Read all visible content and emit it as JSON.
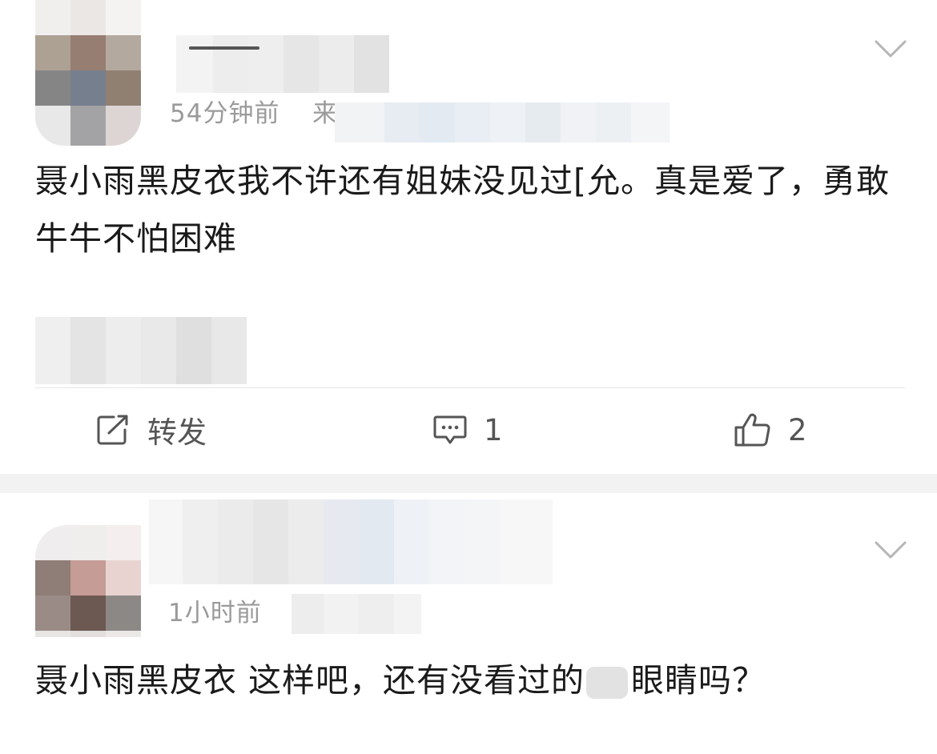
{
  "posts": [
    {
      "time": "54分钟前",
      "source_prefix": "来",
      "text": "聂小雨黑皮衣我不许还有姐妹没见过[允。真是爱了，勇敢牛牛不怕困难",
      "actions": {
        "repost_label": "转发",
        "comment_count": "1",
        "like_count": "2"
      }
    },
    {
      "time": "1小时前",
      "text_before_blur": "聂小雨黑皮衣 这样吧，还有没看过的",
      "text_after_blur": "眼睛吗？"
    }
  ],
  "icons": {
    "menu": "chevron-down-icon",
    "repost": "edit-share-icon",
    "comment": "comment-bubble-icon",
    "like": "thumbs-up-icon"
  },
  "colors": {
    "text": "#1a1a1a",
    "meta": "#9a9a9a",
    "action": "#555555",
    "separator": "#f2f2f2"
  }
}
